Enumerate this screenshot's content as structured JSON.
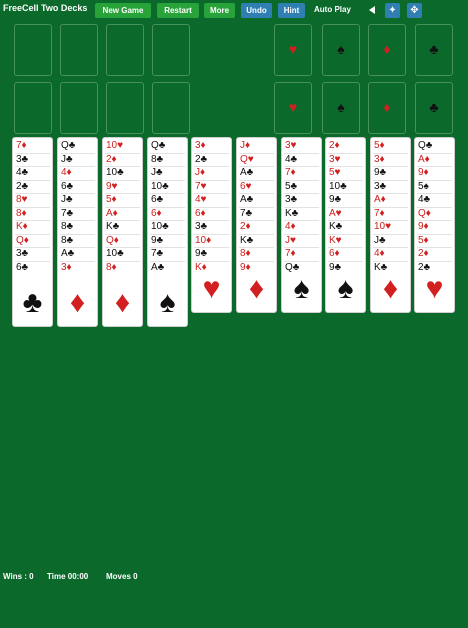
{
  "title": "FreeCell Two Decks",
  "buttons": {
    "new_game": "New Game",
    "restart": "Restart",
    "more": "More",
    "undo": "Undo",
    "hint": "Hint"
  },
  "auto_play": "Auto Play",
  "icons": [
    "previous-triangle-icon",
    "settings-icon",
    "fullscreen-icon"
  ],
  "foundation_suits": [
    "♥",
    "♠",
    "♦",
    "♣"
  ],
  "foundation_colors": [
    "r",
    "b",
    "r",
    "b"
  ],
  "columns": [
    {
      "cards": [
        "7♦",
        "3♣",
        "4♣",
        "2♣",
        "8♥",
        "8♦",
        "K♦",
        "Q♦",
        "3♣",
        "6♣"
      ],
      "suit": "♣",
      "color": "b"
    },
    {
      "cards": [
        "Q♣",
        "J♣",
        "4♦",
        "6♣",
        "J♣",
        "7♣",
        "8♣",
        "8♣",
        "A♣",
        "3♦"
      ],
      "suit": "♦",
      "color": "r"
    },
    {
      "cards": [
        "10♥",
        "2♦",
        "10♣",
        "9♥",
        "5♦",
        "A♦",
        "K♣",
        "Q♦",
        "10♣",
        "8♦"
      ],
      "suit": "♦",
      "color": "r"
    },
    {
      "cards": [
        "Q♣",
        "8♣",
        "J♣",
        "10♣",
        "6♣",
        "6♦",
        "10♣",
        "9♣",
        "7♣",
        "A♣"
      ],
      "suit": "♠",
      "color": "b"
    },
    {
      "cards": [
        "3♦",
        "2♣",
        "J♦",
        "7♥",
        "4♥",
        "6♦",
        "3♣",
        "10♦",
        "9♣",
        "K♦"
      ],
      "suit": "♥",
      "color": "r"
    },
    {
      "cards": [
        "J♦",
        "Q♥",
        "A♣",
        "6♥",
        "A♣",
        "7♣",
        "2♦",
        "K♣",
        "8♦",
        "9♦"
      ],
      "suit": "♦",
      "color": "r"
    },
    {
      "cards": [
        "3♥",
        "4♣",
        "7♦",
        "5♣",
        "3♣",
        "K♣",
        "4♦",
        "J♥",
        "7♦",
        "Q♣"
      ],
      "suit": "♠",
      "color": "b"
    },
    {
      "cards": [
        "2♦",
        "3♥",
        "5♥",
        "10♣",
        "9♣",
        "A♥",
        "K♣",
        "K♥",
        "6♦",
        "9♣"
      ],
      "suit": "♠",
      "color": "b"
    },
    {
      "cards": [
        "5♦",
        "3♦",
        "9♣",
        "3♣",
        "A♦",
        "7♦",
        "10♥",
        "J♣",
        "4♦",
        "K♣"
      ],
      "suit": "♦",
      "color": "r"
    },
    {
      "cards": [
        "Q♣",
        "A♦",
        "9♦",
        "5♠",
        "4♣",
        "Q♦",
        "9♦",
        "5♦",
        "2♦",
        "2♣"
      ],
      "suit": "♥",
      "color": "r"
    }
  ],
  "status": {
    "wins": "Wins : 0",
    "time": "Time 00:00",
    "moves": "Moves 0"
  }
}
